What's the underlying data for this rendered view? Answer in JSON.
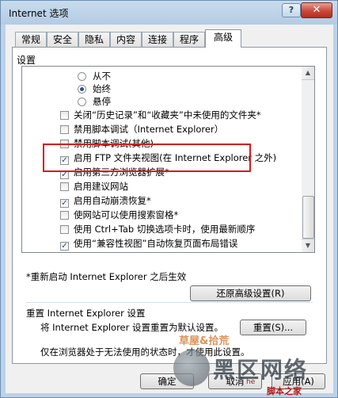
{
  "window": {
    "title": "Internet 选项",
    "help_label": "?",
    "close_label": "✕"
  },
  "tabs": [
    {
      "label": "常规"
    },
    {
      "label": "安全"
    },
    {
      "label": "隐私"
    },
    {
      "label": "内容"
    },
    {
      "label": "连接"
    },
    {
      "label": "程序"
    },
    {
      "label": "高级",
      "active": true
    }
  ],
  "settings": {
    "group_label": "设置",
    "items": [
      {
        "type": "radio",
        "label": "从不",
        "checked": false
      },
      {
        "type": "radio",
        "label": "始终",
        "checked": true
      },
      {
        "type": "radio",
        "label": "悬停",
        "checked": false
      },
      {
        "type": "checkbox",
        "label": "关闭“历史记录”和“收藏夹”中未使用的文件夹*",
        "checked": false
      },
      {
        "type": "checkbox",
        "label": "禁用脚本调试（Internet Explorer）",
        "checked": false
      },
      {
        "type": "checkbox",
        "label": "禁用脚本调试(其他)",
        "checked": false
      },
      {
        "type": "checkbox",
        "label": "启用 FTP 文件夹视图(在 Internet Explorer 之外)",
        "checked": true
      },
      {
        "type": "checkbox",
        "label": "启用第三方浏览器扩展*",
        "checked": true
      },
      {
        "type": "checkbox",
        "label": "启用建议网站",
        "checked": false
      },
      {
        "type": "checkbox",
        "label": "启用自动崩溃恢复*",
        "checked": true
      },
      {
        "type": "checkbox",
        "label": "使网站可以使用搜索窗格*",
        "checked": false
      },
      {
        "type": "checkbox",
        "label": "使用 Ctrl+Tab 切换选项卡时，使用最新顺序",
        "checked": false
      },
      {
        "type": "checkbox",
        "label": "使用“兼容性视图”自动恢复页面布局错误",
        "checked": true
      }
    ],
    "restart_note": "*重新启动 Internet Explorer 之后生效",
    "restore_button": "还原高级设置(R)"
  },
  "reset": {
    "heading": "重置 Internet Explorer 设置",
    "description": "将 Internet Explorer 设置重置为默认设置。",
    "button": "重置(S)...",
    "hint": "仅在浏览器处于无法使用的状态时，才使用此设置。"
  },
  "footer": {
    "ok": "确定",
    "cancel": "取消",
    "apply": "应用(A)"
  },
  "watermark": {
    "line1": "草屋&拾荒",
    "line2": "黑区网络",
    "line3": "he",
    "line4": "脚本之家"
  }
}
